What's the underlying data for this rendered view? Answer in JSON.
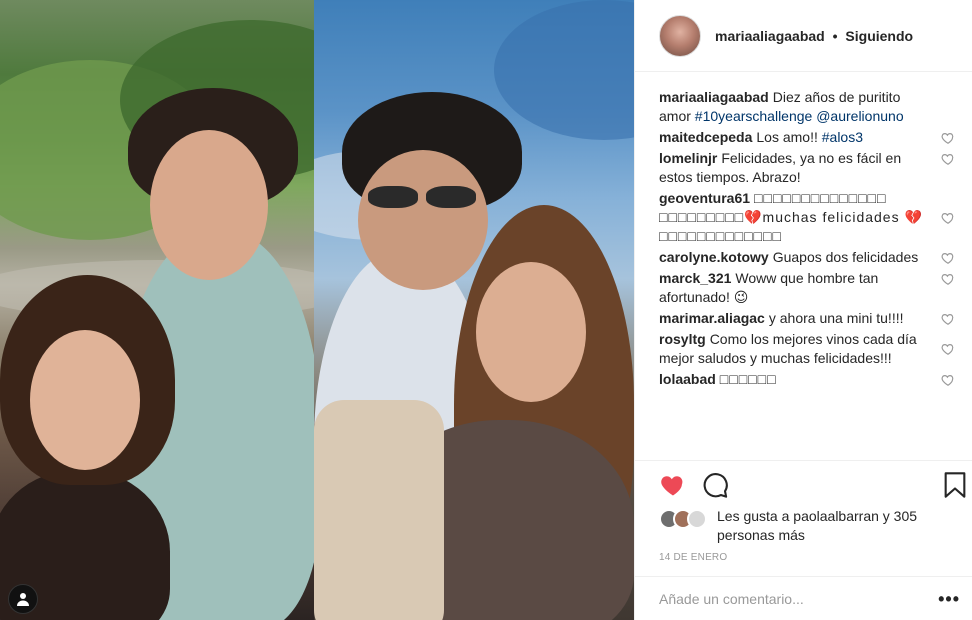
{
  "post": {
    "username": "mariaaliagaabad",
    "separator": "•",
    "follow_status": "Siguiendo",
    "caption": {
      "username": "mariaaliagaabad",
      "text": "Diez años de puritito amor",
      "hashtag": "#10yearschallenge",
      "mention": "@aurelionuno"
    },
    "comments": [
      {
        "user": "maitedcepeda",
        "text": "Los amo!!",
        "tag": "#alos3"
      },
      {
        "user": "lomelinjr",
        "text": "Felicidades, ya no es fácil en estos tiempos. Abrazo!"
      },
      {
        "user": "geoventura61",
        "text": "□□□□□□□□□□□□□□ □□□□□□□□□💔muchas felicidades 💔 □□□□□□□□□□□□□"
      },
      {
        "user": "carolyne.kotowy",
        "text": "Guapos dos felicidades"
      },
      {
        "user": "marck_321",
        "text": "Woww que hombre tan afortunado! 😉"
      },
      {
        "user": "marimar.aliagac",
        "text": "y ahora una mini tu!!!!"
      },
      {
        "user": "rosyltg",
        "text": "Como los mejores vinos cada día mejor saludos y muchas felicidades!!!"
      },
      {
        "user": "lolaabad",
        "text": "□□□□□□"
      }
    ],
    "likes_prefix": "Les gusta a",
    "likes_user": "paolaalbarran",
    "likes_suffix": "y 305 personas más",
    "date": "14 DE ENERO",
    "add_comment_placeholder": "Añade un comentario...",
    "more_label": "•••"
  },
  "icons": {
    "heart_filled": "heart-filled-icon",
    "comment": "comment-bubble-icon",
    "bookmark": "bookmark-icon",
    "heart_outline": "heart-outline-icon",
    "user_tag": "user-tag-icon"
  },
  "colors": {
    "like_red": "#ed4956",
    "hashtag_blue": "#003569",
    "meta_gray": "#999999"
  }
}
